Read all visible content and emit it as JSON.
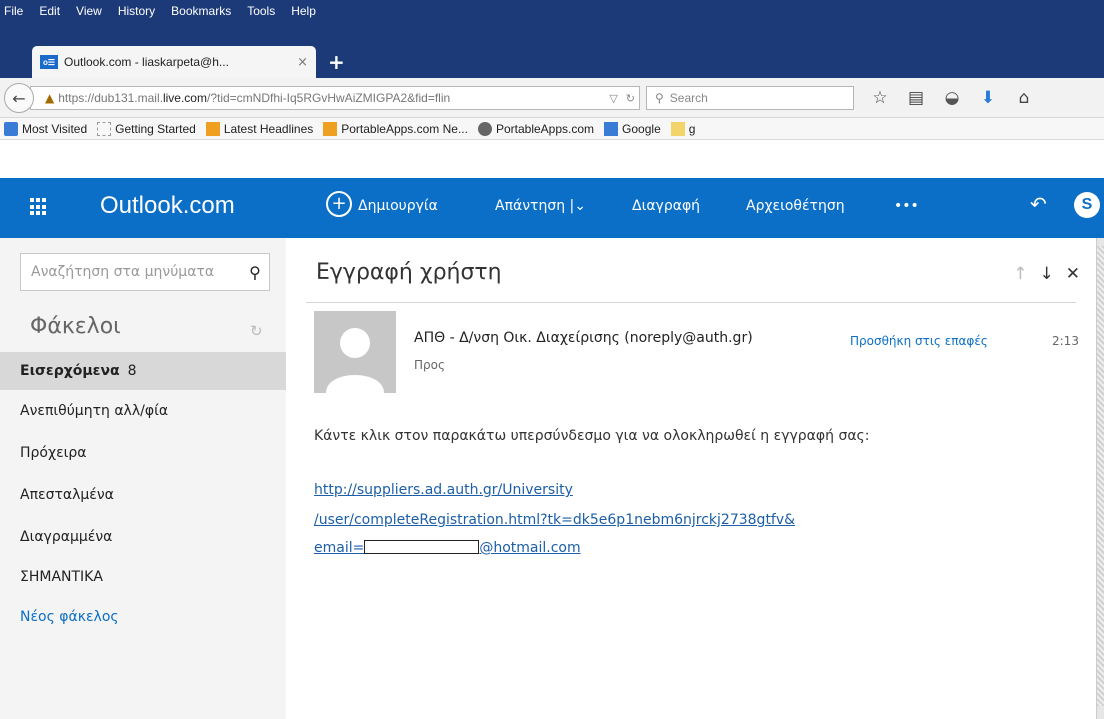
{
  "browser": {
    "menu": [
      "File",
      "Edit",
      "View",
      "History",
      "Bookmarks",
      "Tools",
      "Help"
    ],
    "tab_title": "Outlook.com - liaskarpeta@h...",
    "tab_close": "×",
    "new_tab": "+",
    "url_prefix": "https://dub131.mail.",
    "url_domain": "live.com",
    "url_rest": "/?tid=cmNDfhi-Iq5RGvHwAiZMIGPA2&fid=flin",
    "search_placeholder": "Search",
    "bookmarks": [
      "Most Visited",
      "Getting Started",
      "Latest Headlines",
      "PortableApps.com Ne...",
      "PortableApps.com",
      "Google",
      "g"
    ]
  },
  "outlook": {
    "brand": "Outlook.com",
    "commands": {
      "new": "Δημιουργία",
      "reply": "Απάντηση |",
      "reply_chevron": "⌄",
      "delete": "Διαγραφή",
      "archive": "Αρχειοθέτηση",
      "more": "•••"
    },
    "search_placeholder": "Αναζήτηση στα μηνύματα",
    "folders_title": "Φάκελοι",
    "folders": [
      {
        "label": "Εισερχόμενα",
        "count": "8"
      },
      {
        "label": "Ανεπιθύμητη αλλ/φία"
      },
      {
        "label": "Πρόχειρα"
      },
      {
        "label": "Απεσταλμένα"
      },
      {
        "label": "Διαγραμμένα"
      },
      {
        "label": "ΣΗΜΑΝΤΙΚΑ"
      }
    ],
    "new_folder": "Νέος φάκελος"
  },
  "message": {
    "subject": "Εγγραφή χρήστη",
    "sender": "ΑΠΘ - Δ/νση Οικ. Διαχείρισης (noreply@auth.gr)",
    "add_contact": "Προσθήκη στις επαφές",
    "time": "2:13",
    "to_label": "Προς",
    "body": "Κάντε κλικ στον παρακάτω υπερσύνδεσμο για να ολοκληρωθεί η εγγραφή σας:",
    "link_line1": "http://suppliers.ad.auth.gr/University",
    "link_line2": "/user/completeRegistration.html?tk=dk5e6p1nebm6njrckj2738gtfv&",
    "link_line3_prefix": "email=",
    "link_line3_suffix": "@hotmail.com"
  },
  "colors": {
    "outlook_blue": "#0b6fc7",
    "firefox_frame": "#1c3a78"
  }
}
